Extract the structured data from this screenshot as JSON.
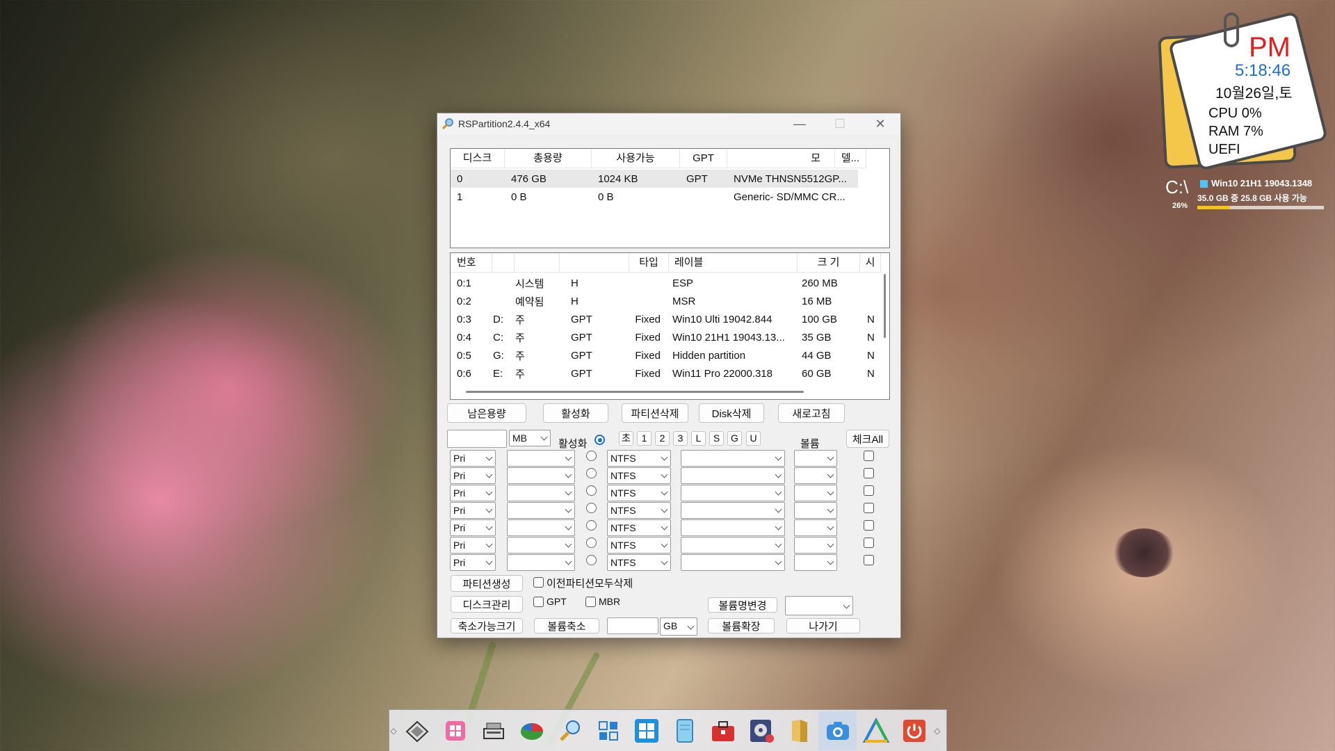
{
  "window": {
    "title": "RSPartition2.4.4_x64",
    "min_glyph": "—",
    "max_glyph": "☐",
    "close_glyph": "✕"
  },
  "disk_list": {
    "headers": [
      "디스크",
      "총용량",
      "사용가능",
      "GPT",
      "모",
      "델..."
    ],
    "rows": [
      [
        "0",
        "476 GB",
        "1024 KB",
        "GPT",
        "NVMe THNSN5512GP..."
      ],
      [
        "1",
        "0 B",
        "0 B",
        "",
        "Generic- SD/MMC CR..."
      ]
    ]
  },
  "partition_list": {
    "headers": [
      "번호",
      "",
      "",
      "타입",
      "레이블",
      "크 기",
      "시"
    ],
    "rows": [
      [
        "0:1",
        "",
        "시스템",
        "H",
        "",
        "ESP",
        "260 MB",
        ""
      ],
      [
        "0:2",
        "",
        "예약됨",
        "H",
        "",
        "MSR",
        "16 MB",
        ""
      ],
      [
        "0:3",
        "D:",
        "주",
        "GPT",
        "Fixed",
        "Win10 Ulti 19042.844",
        "100 GB",
        "N"
      ],
      [
        "0:4",
        "C:",
        "주",
        "GPT",
        "Fixed",
        "Win10 21H1 19043.13...",
        "35 GB",
        "N"
      ],
      [
        "0:5",
        "G:",
        "주",
        "GPT",
        "Fixed",
        "Hidden partition",
        "44 GB",
        "N"
      ],
      [
        "0:6",
        "E:",
        "주",
        "GPT",
        "Fixed",
        "Win11 Pro 22000.318",
        "60 GB",
        "N"
      ]
    ]
  },
  "action_buttons": [
    "남은용량",
    "활성화",
    "파티션삭제",
    "Disk삭제",
    "새로고침"
  ],
  "form": {
    "size_unit": "MB",
    "active_label": "활성화",
    "letter_buttons": [
      "초",
      "1",
      "2",
      "3",
      "L",
      "S",
      "G",
      "U"
    ],
    "volume_label": "볼륨",
    "check_all": "체크All",
    "rows": [
      {
        "type": "Pri",
        "fs": "NTFS"
      },
      {
        "type": "Pri",
        "fs": "NTFS"
      },
      {
        "type": "Pri",
        "fs": "NTFS"
      },
      {
        "type": "Pri",
        "fs": "NTFS"
      },
      {
        "type": "Pri",
        "fs": "NTFS"
      },
      {
        "type": "Pri",
        "fs": "NTFS"
      },
      {
        "type": "Pri",
        "fs": "NTFS"
      }
    ]
  },
  "bottom": {
    "create_partition": "파티션생성",
    "delete_previous": "이전파티션모두삭제",
    "disk_manage": "디스크관리",
    "gpt": "GPT",
    "mbr": "MBR",
    "rename_volume": "볼륨명변경",
    "shrinkable": "축소가능크기",
    "shrink_volume": "볼륨축소",
    "shrink_unit": "GB",
    "extend_volume": "볼륨확장",
    "exit": "나가기"
  },
  "widget": {
    "ampm": "PM",
    "time": "5:18:46",
    "date": "10월26일,토",
    "cpu": "CPU  0%",
    "ram": "RAM  7%",
    "boot": "UEFI",
    "drive": "C:\\",
    "os": "Win10 21H1 19043.1348",
    "space": "35.0 GB 중  25.8 GB 사용 가능",
    "usage_percent": "26%",
    "usage_fraction": 0.26
  },
  "taskbar": {
    "left_arrow": "◇",
    "right_arrow": "◇",
    "icons": [
      "drive-tool-icon",
      "start-menu-icon",
      "scanner-icon",
      "partition-pie-icon",
      "rspartition-icon",
      "tiles-icon",
      "windows-icon",
      "notepad-icon",
      "toolbox-icon",
      "disk-tool-icon",
      "folder-icon",
      "camera-icon",
      "triangle-icon",
      "power-icon"
    ]
  }
}
